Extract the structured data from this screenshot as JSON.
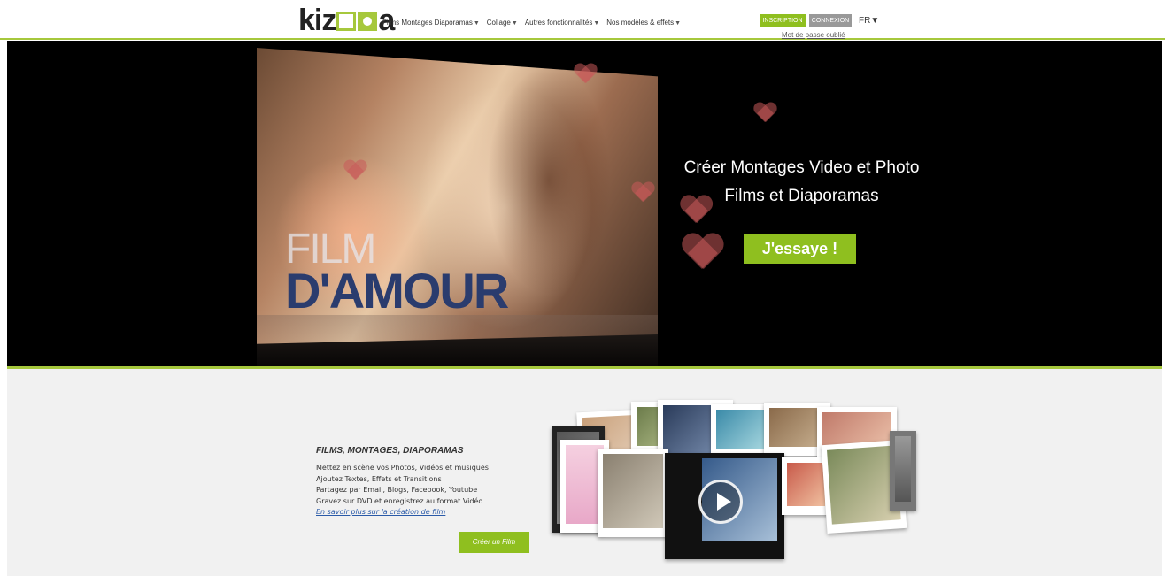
{
  "header": {
    "logo_text_start": "kiz",
    "logo_text_end": "a",
    "nav": [
      {
        "label": "Films Montages Diaporamas"
      },
      {
        "label": "Collage"
      },
      {
        "label": "Autres fonctionnalités"
      },
      {
        "label": "Nos modèles & effets"
      }
    ],
    "caret": "▼",
    "signup_label": "INSCRIPTION",
    "login_label": "CONNEXION",
    "lang_label": "FR▼",
    "forgot_password": "Mot de passe oublié"
  },
  "hero": {
    "film_title_line1": "FILM",
    "film_title_line2": "D'AMOUR",
    "headline_line1": "Créer Montages Video et Photo",
    "headline_line2": "Films et Diaporamas",
    "cta_label": "J'essaye !"
  },
  "features": {
    "title": "FILMS, MONTAGES, DIAPORAMAS",
    "lines": [
      "Mettez en scène vos Photos, Vidéos et musiques",
      "Ajoutez Textes, Effets et Transitions",
      "Partagez par Email, Blogs, Facebook, Youtube",
      "Gravez sur DVD et enregistrez au format Vidéo"
    ],
    "link_label": "En savoir plus sur la création de film",
    "button_label": "Créer un Film"
  },
  "colors": {
    "accent": "#8fbf1f",
    "link": "#2a5aa8",
    "hero_bg": "#000000"
  }
}
